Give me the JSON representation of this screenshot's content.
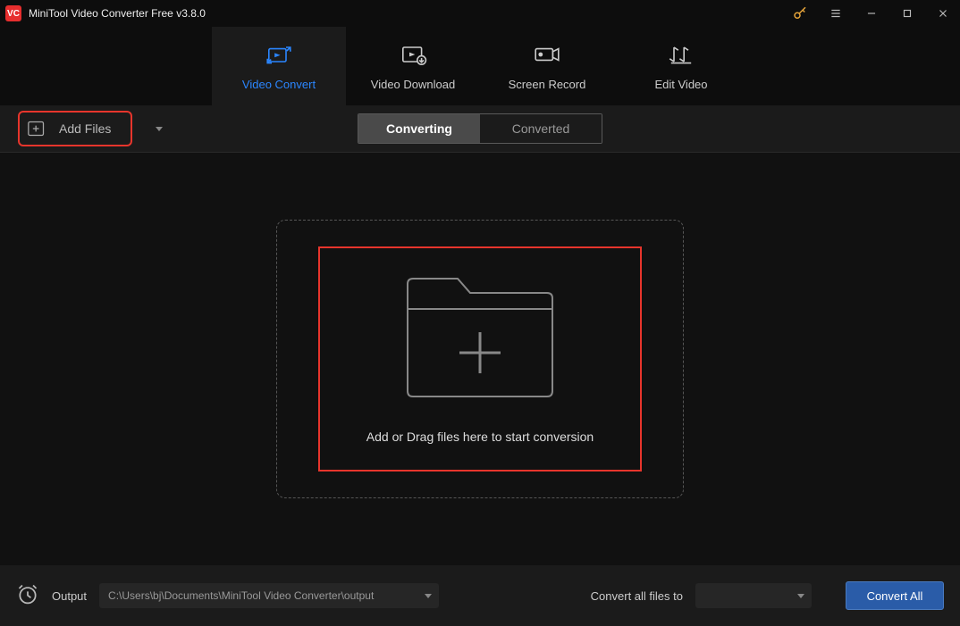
{
  "titlebar": {
    "app_name": "MiniTool Video Converter Free v3.8.0"
  },
  "nav": {
    "items": [
      {
        "label": "Video Convert"
      },
      {
        "label": "Video Download"
      },
      {
        "label": "Screen Record"
      },
      {
        "label": "Edit Video"
      }
    ]
  },
  "toolbar": {
    "add_files_label": "Add Files",
    "seg": [
      {
        "label": "Converting"
      },
      {
        "label": "Converted"
      }
    ]
  },
  "dropzone": {
    "text": "Add or Drag files here to start conversion"
  },
  "bottom": {
    "output_label": "Output",
    "output_path": "C:\\Users\\bj\\Documents\\MiniTool Video Converter\\output",
    "convert_to_label": "Convert all files to",
    "convert_all_label": "Convert All"
  }
}
